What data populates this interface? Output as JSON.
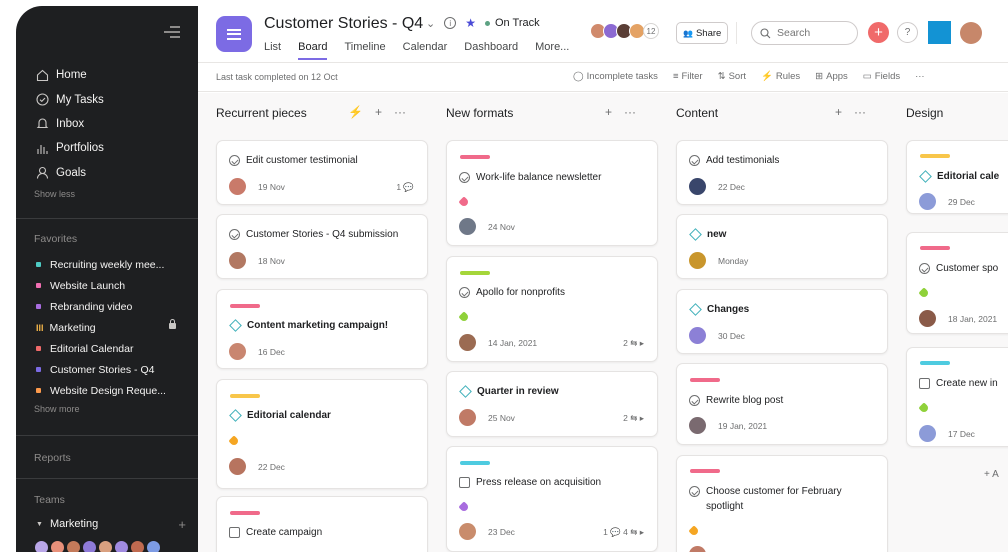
{
  "sidebar": {
    "nav": [
      {
        "label": "Home",
        "icon": "home-icon"
      },
      {
        "label": "My Tasks",
        "icon": "check-circle-icon"
      },
      {
        "label": "Inbox",
        "icon": "bell-icon"
      },
      {
        "label": "Portfolios",
        "icon": "bar-chart-icon"
      },
      {
        "label": "Goals",
        "icon": "person-icon"
      }
    ],
    "show_less": "Show less",
    "favorites_title": "Favorites",
    "favorites": [
      {
        "label": "Recruiting weekly mee...",
        "color": "#4ecbc4"
      },
      {
        "label": "Website Launch",
        "color": "#f26fb2"
      },
      {
        "label": "Rebranding video",
        "color": "#a86cdf"
      },
      {
        "label": "Marketing",
        "color": "#f8b84a"
      },
      {
        "label": "Editorial Calendar",
        "color": "#f06a6a"
      },
      {
        "label": "Customer Stories - Q4",
        "color": "#7c6be4"
      },
      {
        "label": "Website Design Reque...",
        "color": "#fd9a4c"
      }
    ],
    "show_more": "Show more",
    "reports": "Reports",
    "teams_title": "Teams",
    "team_name": "Marketing",
    "team_member_colors": [
      "#b9a6e8",
      "#e8907a",
      "#c47a5a",
      "#8e7ad8",
      "#d9a080",
      "#a08ae0",
      "#c06a50",
      "#7d9be4"
    ]
  },
  "header": {
    "title": "Customer Stories - Q4",
    "status": "On Track",
    "status_color": "#5da283",
    "tabs": [
      "List",
      "Board",
      "Timeline",
      "Calendar",
      "Dashboard",
      "More..."
    ],
    "active_tab": "Board",
    "member_count": "12",
    "member_colors": [
      "#d08a6c",
      "#8c6ad2",
      "#5a3e36",
      "#e4a264"
    ],
    "share": "Share",
    "search_placeholder": "Search",
    "last_completed": "Last task completed on 12 Oct",
    "tools": [
      "Incomplete tasks",
      "Filter",
      "Sort",
      "Rules",
      "Apps",
      "Fields",
      "···"
    ]
  },
  "board": {
    "columns": [
      {
        "name": "Recurrent pieces",
        "cards": [
          {
            "title": "Edit customer testimonial",
            "date": "19 Nov",
            "meta": "1 💬",
            "avatar": "#c97a6a"
          },
          {
            "title": "Customer Stories - Q4 submission",
            "date": "18 Nov",
            "meta": "",
            "avatar": "#b27862"
          },
          {
            "title": "Content marketing campaign!",
            "date": "16 Dec",
            "meta": "",
            "avatar": "#c98670",
            "strip": "#f06a8a"
          },
          {
            "title": "Editorial calendar",
            "date": "22 Dec",
            "meta": "",
            "avatar": "#b7745f",
            "strip": "#f8c64a",
            "tag": "#f5a623"
          },
          {
            "title": "Create campaign",
            "date": "",
            "meta": "",
            "avatar": "",
            "strip": "#f06a8a"
          }
        ]
      },
      {
        "name": "New formats",
        "cards": [
          {
            "title": "Work-life balance newsletter",
            "date": "24 Nov",
            "meta": "",
            "avatar": "#6f7888",
            "strip": "#f06a8a",
            "tag": "#f06a8a"
          },
          {
            "title": "Apollo for nonprofits",
            "date": "14 Jan, 2021",
            "meta": "2 ⇆ ▸",
            "avatar": "#9b6b52",
            "strip": "#a5d63a",
            "tag": "#8fd13a"
          },
          {
            "title": "Quarter in review",
            "date": "25 Nov",
            "meta": "2 ⇆ ▸",
            "avatar": "#c07a66"
          },
          {
            "title": "Press release on acquisition",
            "date": "23 Dec",
            "meta": "1 💬  4 ⇆ ▸",
            "avatar": "#c98c6c",
            "strip": "#4ecbe0",
            "tag": "#a86cdf"
          }
        ]
      },
      {
        "name": "Content",
        "cards": [
          {
            "title": "Add testimonials",
            "date": "22 Dec",
            "meta": "",
            "avatar": "#39466b"
          },
          {
            "title": "new",
            "date": "Monday",
            "meta": "",
            "avatar": "#c9962c"
          },
          {
            "title": "Changes",
            "date": "30 Dec",
            "meta": "",
            "avatar": "#8c80d6"
          },
          {
            "title": "Rewrite blog post",
            "date": "19 Jan, 2021",
            "meta": "",
            "avatar": "#7a6a70",
            "strip": "#f06a8a"
          },
          {
            "title": "Choose customer for February spotlight",
            "date": "",
            "meta": "",
            "avatar": "#c07a66",
            "strip": "#f06a8a",
            "tag": "#f5a623"
          }
        ]
      },
      {
        "name": "Design",
        "cards": [
          {
            "title": "Editorial cale",
            "date": "29 Dec",
            "meta": "",
            "avatar": "#8c9bd8",
            "strip": "#f8c64a"
          },
          {
            "title": "Customer spo",
            "date": "18 Jan, 2021",
            "meta": "",
            "avatar": "#8a5a48",
            "strip": "#f06a8a",
            "tag": "#8fd13a"
          },
          {
            "title": "Create new in",
            "date": "17 Dec",
            "meta": "",
            "avatar": "#8c9bd8",
            "strip": "#4ecbe0",
            "tag": "#8fd13a"
          }
        ],
        "add": "+ A"
      }
    ]
  }
}
